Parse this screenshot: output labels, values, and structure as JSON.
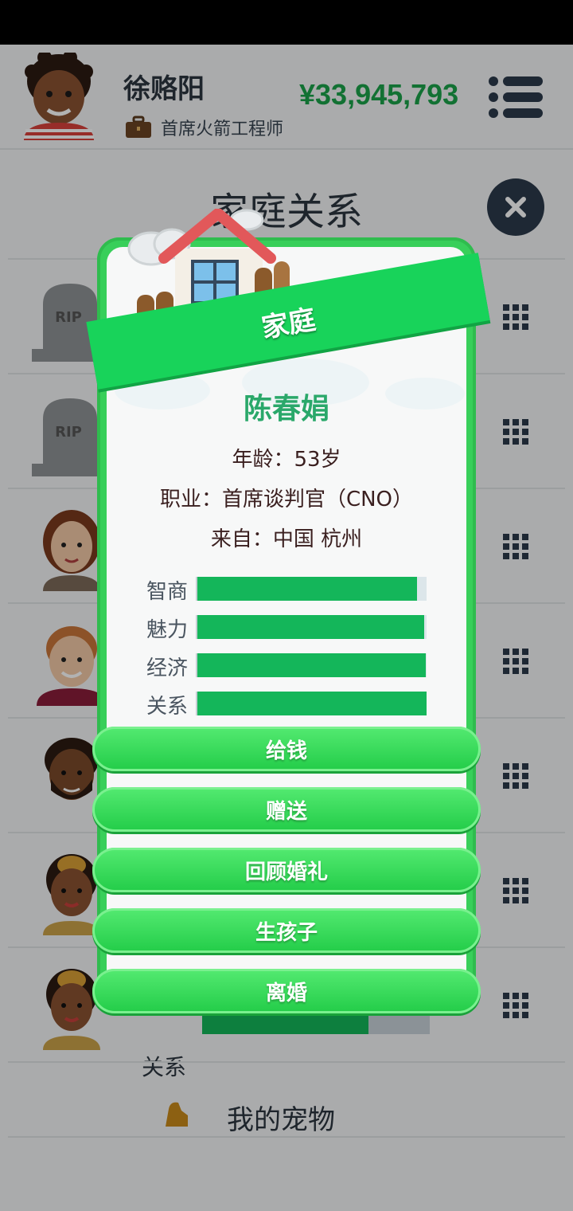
{
  "player": {
    "name": "徐赂阳",
    "job": "首席火箭工程师",
    "money": "¥33,945,793"
  },
  "page": {
    "title": "家庭关系"
  },
  "rows": [
    {
      "type": "grave",
      "label": "RIP"
    },
    {
      "type": "grave",
      "label": "RIP"
    },
    {
      "type": "person",
      "avatar": "woman-avatar"
    },
    {
      "type": "person",
      "avatar": "man-avatar"
    },
    {
      "type": "person",
      "avatar": "bearded-man-avatar"
    },
    {
      "type": "person",
      "avatar": "girl-avatar"
    },
    {
      "type": "person",
      "avatar": "girl-avatar"
    }
  ],
  "underlay": {
    "stat_label": "关系",
    "bottom_label": "我的宠物"
  },
  "card": {
    "banner": "家庭",
    "name": "陈春娟",
    "age": "年龄：53岁",
    "occupation": "职业：首席谈判官（CNO）",
    "origin": "来自：中国 杭州",
    "stats": [
      {
        "label": "智商",
        "value": 0.96
      },
      {
        "label": "魅力",
        "value": 0.99
      },
      {
        "label": "经济",
        "value": 0.995
      },
      {
        "label": "关系",
        "value": 1.0
      }
    ],
    "actions": [
      "给钱",
      "赠送",
      "回顾婚礼",
      "生孩子",
      "离婚"
    ]
  },
  "colors": {
    "money": "#1aa34a",
    "banner": "#18d35a",
    "stat_fill": "#14b65a",
    "name": "#2aa86a"
  }
}
